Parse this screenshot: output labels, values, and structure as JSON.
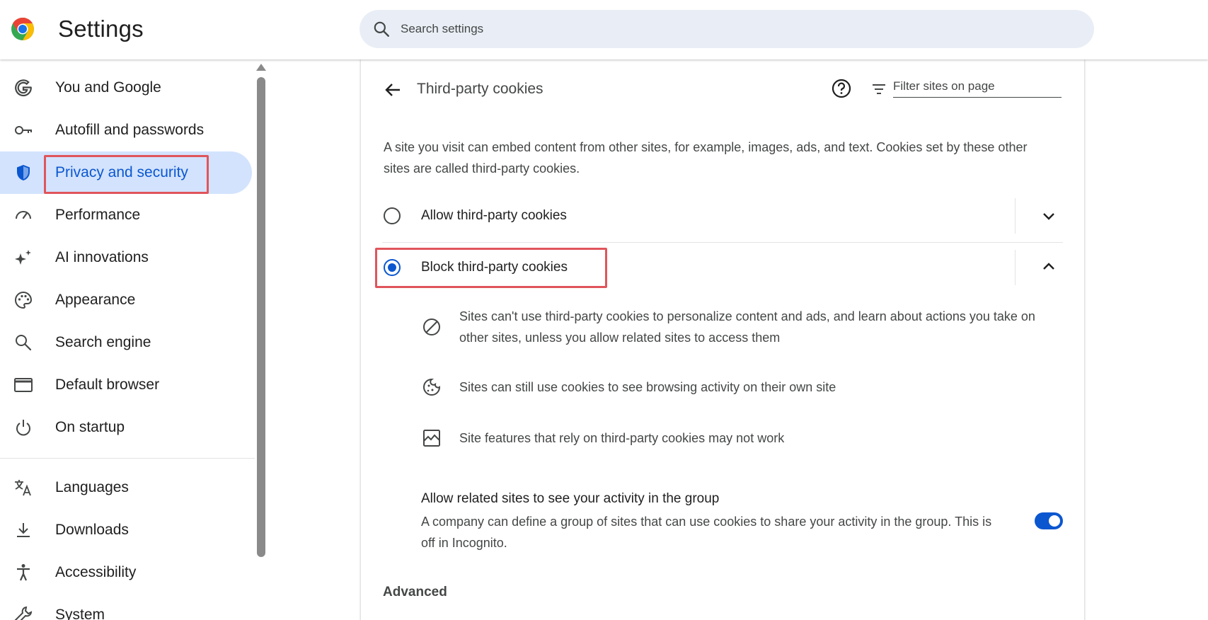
{
  "header": {
    "title": "Settings",
    "search_placeholder": "Search settings"
  },
  "sidebar": {
    "items": [
      {
        "label": "You and Google",
        "icon": "google-g-icon"
      },
      {
        "label": "Autofill and passwords",
        "icon": "key-icon"
      },
      {
        "label": "Privacy and security",
        "icon": "shield-icon",
        "active": true
      },
      {
        "label": "Performance",
        "icon": "speedometer-icon"
      },
      {
        "label": "AI innovations",
        "icon": "sparkle-icon"
      },
      {
        "label": "Appearance",
        "icon": "palette-icon"
      },
      {
        "label": "Search engine",
        "icon": "search-icon"
      },
      {
        "label": "Default browser",
        "icon": "browser-window-icon"
      },
      {
        "label": "On startup",
        "icon": "power-icon"
      },
      {
        "label": "Languages",
        "icon": "translate-icon"
      },
      {
        "label": "Downloads",
        "icon": "download-icon"
      },
      {
        "label": "Accessibility",
        "icon": "accessibility-icon"
      },
      {
        "label": "System",
        "icon": "wrench-icon"
      }
    ]
  },
  "page": {
    "title": "Third-party cookies",
    "filter_placeholder": "Filter sites on page",
    "description": "A site you visit can embed content from other sites, for example, images, ads, and text. Cookies set by these other sites are called third-party cookies.",
    "options": [
      {
        "label": "Allow third-party cookies",
        "selected": false,
        "expanded": false
      },
      {
        "label": "Block third-party cookies",
        "selected": true,
        "expanded": true
      }
    ],
    "details": [
      {
        "icon": "block-icon",
        "text": "Sites can't use third-party cookies to personalize content and ads, and learn about actions you take on other sites, unless you allow related sites to access them"
      },
      {
        "icon": "cookie-icon",
        "text": "Sites can still use cookies to see browsing activity on their own site"
      },
      {
        "icon": "broken-image-icon",
        "text": "Site features that rely on third-party cookies may not work"
      }
    ],
    "related_sites": {
      "title": "Allow related sites to see your activity in the group",
      "description": "A company can define a group of sites that can use cookies to share your activity in the group. This is off in Incognito.",
      "enabled": true
    },
    "advanced_heading": "Advanced"
  },
  "colors": {
    "accent": "#0b57d0",
    "active_nav_bg": "#d3e3fd",
    "highlight_box": "#e0555b",
    "search_bg": "#e9eef6"
  }
}
